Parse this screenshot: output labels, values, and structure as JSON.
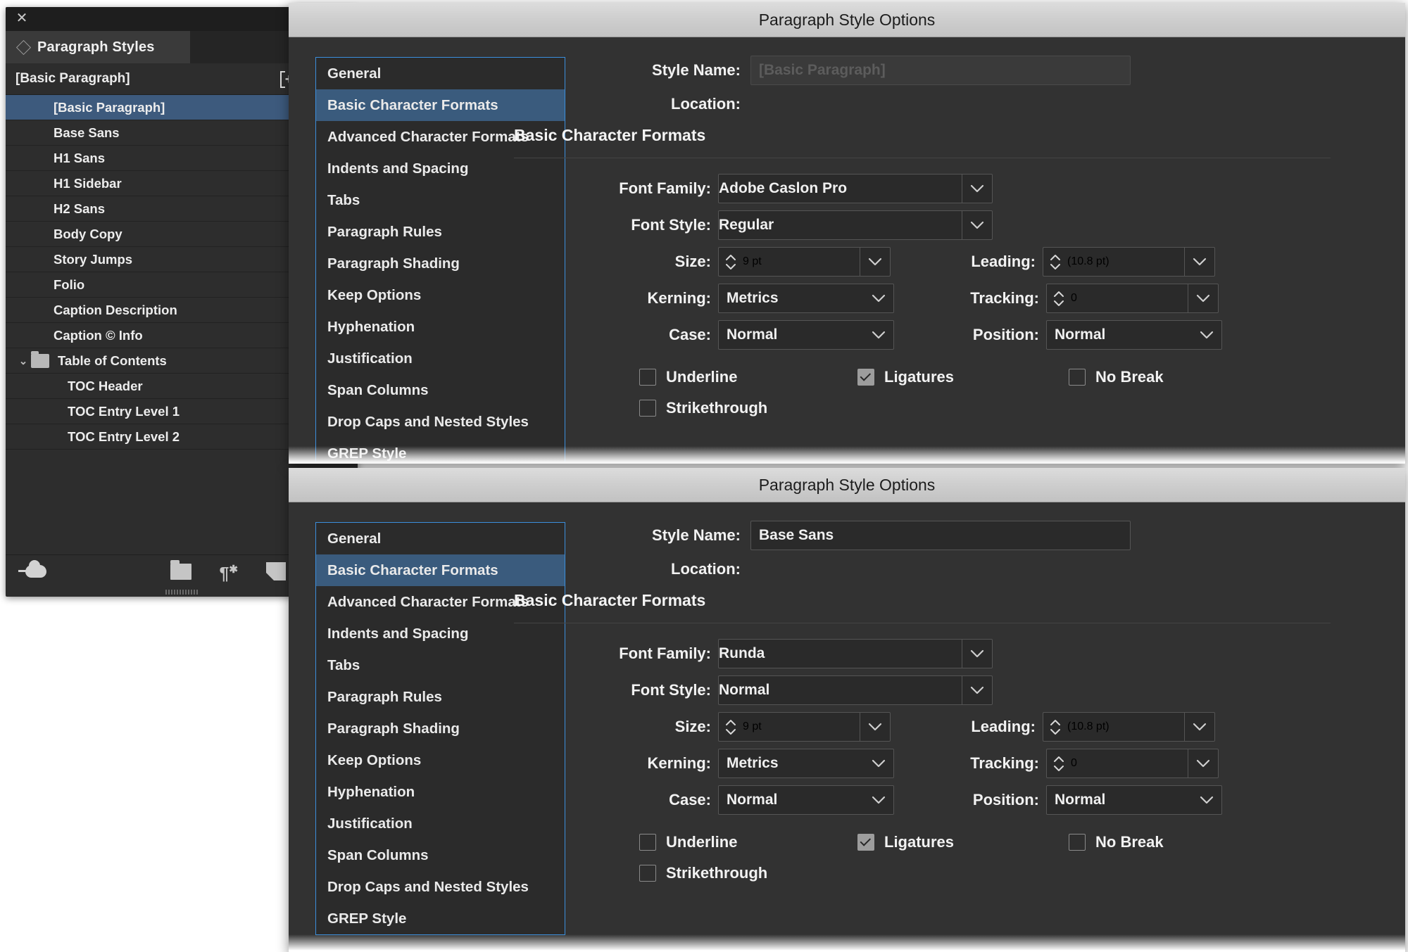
{
  "panel": {
    "close_icon": "close-icon",
    "collapse_icon": "collapse-panel-icon",
    "tab_label": "Paragraph Styles",
    "menu_icon": "panel-menu-icon",
    "current_style": "[Basic Paragraph]",
    "new_style_icon": "new-style-icon",
    "clear_override_icon": "clear-overrides-icon",
    "items": [
      {
        "label": "[Basic Paragraph]",
        "indent": 1,
        "selected": true,
        "type": "style"
      },
      {
        "label": "Base Sans",
        "indent": 1,
        "selected": false,
        "type": "style"
      },
      {
        "label": "H1 Sans",
        "indent": 1,
        "selected": false,
        "type": "style"
      },
      {
        "label": "H1 Sidebar",
        "indent": 1,
        "selected": false,
        "type": "style"
      },
      {
        "label": "H2 Sans",
        "indent": 1,
        "selected": false,
        "type": "style"
      },
      {
        "label": "Body Copy",
        "indent": 1,
        "selected": false,
        "type": "style"
      },
      {
        "label": "Story Jumps",
        "indent": 1,
        "selected": false,
        "type": "style"
      },
      {
        "label": "Folio",
        "indent": 1,
        "selected": false,
        "type": "style"
      },
      {
        "label": "Caption Description",
        "indent": 1,
        "selected": false,
        "type": "style"
      },
      {
        "label": "Caption © Info",
        "indent": 1,
        "selected": false,
        "type": "style"
      },
      {
        "label": "Table of Contents",
        "indent": 0,
        "selected": false,
        "type": "group",
        "expanded": true
      },
      {
        "label": "TOC Header",
        "indent": 2,
        "selected": false,
        "type": "style"
      },
      {
        "label": "TOC Entry Level 1",
        "indent": 2,
        "selected": false,
        "type": "style"
      },
      {
        "label": "TOC Entry Level 2",
        "indent": 2,
        "selected": false,
        "type": "style"
      }
    ],
    "footer_icons": [
      "cloud-upload-icon",
      "new-style-group-icon",
      "clear-overrides-icon",
      "new-style-icon",
      "delete-style-icon"
    ]
  },
  "dialog1": {
    "title": "Paragraph Style Options",
    "nav": [
      {
        "label": "General",
        "selected": false
      },
      {
        "label": "Basic Character Formats",
        "selected": true
      },
      {
        "label": "Advanced Character Formats",
        "selected": false
      },
      {
        "label": "Indents and Spacing",
        "selected": false
      },
      {
        "label": "Tabs",
        "selected": false
      },
      {
        "label": "Paragraph Rules",
        "selected": false
      },
      {
        "label": "Paragraph Shading",
        "selected": false
      },
      {
        "label": "Keep Options",
        "selected": false
      },
      {
        "label": "Hyphenation",
        "selected": false
      },
      {
        "label": "Justification",
        "selected": false
      },
      {
        "label": "Span Columns",
        "selected": false
      },
      {
        "label": "Drop Caps and Nested Styles",
        "selected": false
      },
      {
        "label": "GREP Style",
        "selected": false
      }
    ],
    "style_name_label": "Style Name:",
    "style_name_value": "[Basic Paragraph]",
    "style_name_disabled": true,
    "location_label": "Location:",
    "location_value": "",
    "section_title": "Basic Character Formats",
    "font_family_label": "Font Family:",
    "font_family_value": "Adobe Caslon Pro",
    "font_style_label": "Font Style:",
    "font_style_value": "Regular",
    "size_label": "Size:",
    "size_value": "9 pt",
    "leading_label": "Leading:",
    "leading_value": "(10.8 pt)",
    "kerning_label": "Kerning:",
    "kerning_value": "Metrics",
    "tracking_label": "Tracking:",
    "tracking_value": "0",
    "case_label": "Case:",
    "case_value": "Normal",
    "position_label": "Position:",
    "position_value": "Normal",
    "checkboxes": [
      {
        "label": "Underline",
        "checked": false
      },
      {
        "label": "Ligatures",
        "checked": true
      },
      {
        "label": "No Break",
        "checked": false
      },
      {
        "label": "Strikethrough",
        "checked": false
      }
    ]
  },
  "dialog2": {
    "title": "Paragraph Style Options",
    "nav": [
      {
        "label": "General",
        "selected": false
      },
      {
        "label": "Basic Character Formats",
        "selected": true
      },
      {
        "label": "Advanced Character Formats",
        "selected": false
      },
      {
        "label": "Indents and Spacing",
        "selected": false
      },
      {
        "label": "Tabs",
        "selected": false
      },
      {
        "label": "Paragraph Rules",
        "selected": false
      },
      {
        "label": "Paragraph Shading",
        "selected": false
      },
      {
        "label": "Keep Options",
        "selected": false
      },
      {
        "label": "Hyphenation",
        "selected": false
      },
      {
        "label": "Justification",
        "selected": false
      },
      {
        "label": "Span Columns",
        "selected": false
      },
      {
        "label": "Drop Caps and Nested Styles",
        "selected": false
      },
      {
        "label": "GREP Style",
        "selected": false
      }
    ],
    "style_name_label": "Style Name:",
    "style_name_value": "Base Sans",
    "style_name_disabled": false,
    "location_label": "Location:",
    "location_value": "",
    "section_title": "Basic Character Formats",
    "font_family_label": "Font Family:",
    "font_family_value": "Runda",
    "font_style_label": "Font Style:",
    "font_style_value": "Normal",
    "size_label": "Size:",
    "size_value": "9 pt",
    "leading_label": "Leading:",
    "leading_value": "(10.8 pt)",
    "kerning_label": "Kerning:",
    "kerning_value": "Metrics",
    "tracking_label": "Tracking:",
    "tracking_value": "0",
    "case_label": "Case:",
    "case_value": "Normal",
    "position_label": "Position:",
    "position_value": "Normal",
    "checkboxes": [
      {
        "label": "Underline",
        "checked": false
      },
      {
        "label": "Ligatures",
        "checked": true
      },
      {
        "label": "No Break",
        "checked": false
      },
      {
        "label": "Strikethrough",
        "checked": false
      }
    ]
  },
  "colors": {
    "panel_bg": "#2d2d2d",
    "selection_blue": "#3d5a7d",
    "nav_border_blue": "#3b8fdd",
    "dialog_bg": "#323232",
    "titlebar": "#cfcfcf"
  }
}
